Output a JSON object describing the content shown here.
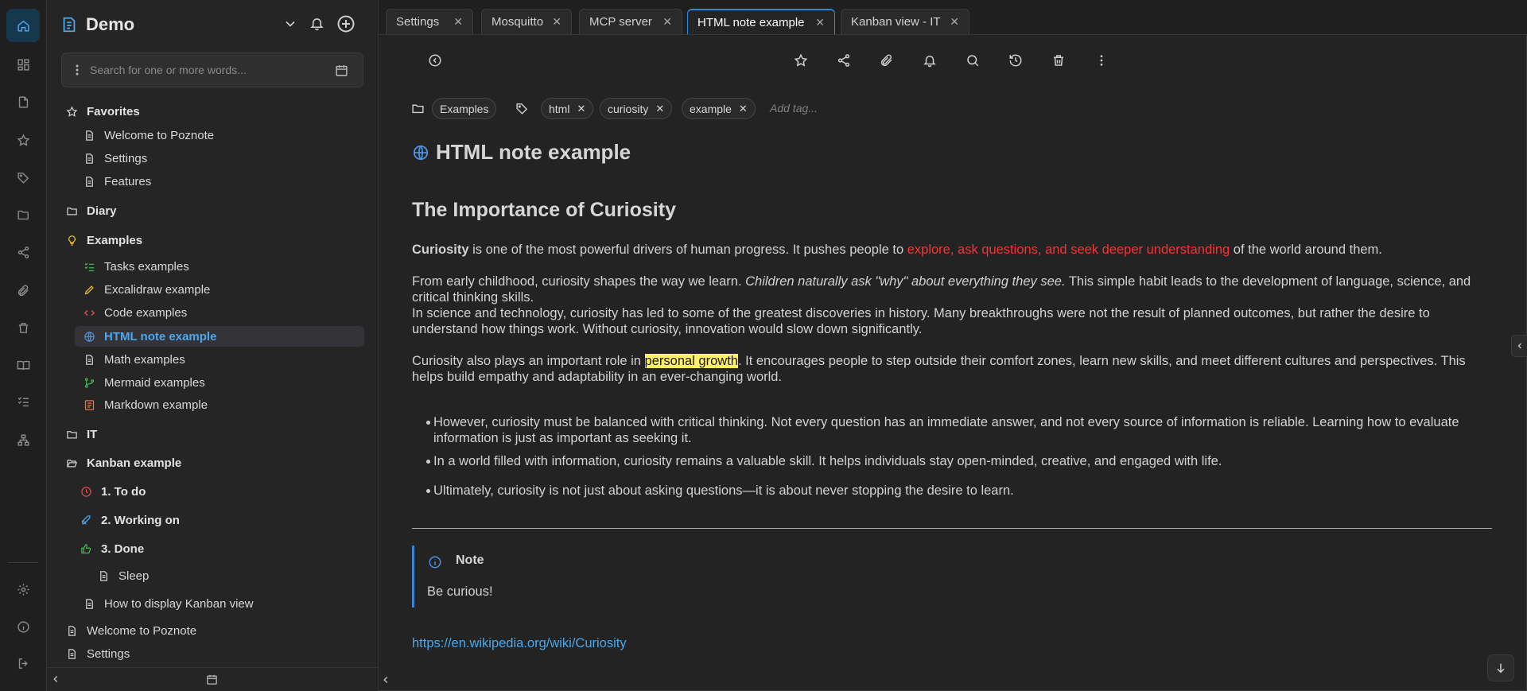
{
  "app": {
    "workspace": "Demo"
  },
  "search": {
    "placeholder": "Search for one or more words..."
  },
  "sidebar": {
    "favorites": {
      "label": "Favorites",
      "items": [
        "Welcome to Poznote",
        "Settings",
        "Features"
      ]
    },
    "diary": "Diary",
    "examples": {
      "label": "Examples",
      "items": [
        "Tasks examples",
        "Excalidraw example",
        "Code examples",
        "HTML note example",
        "Math examples",
        "Mermaid examples",
        "Markdown example"
      ]
    },
    "it": "IT",
    "kanban": {
      "label": "Kanban example",
      "columns": [
        "1. To do",
        "2. Working on",
        "3. Done"
      ],
      "done_items": [
        "Sleep"
      ],
      "items": [
        "How to display Kanban view"
      ]
    },
    "root_items": [
      "Welcome to Poznote",
      "Settings"
    ]
  },
  "tabs": [
    "Settings",
    "Mosquitto",
    "MCP server",
    "HTML note example",
    "Kanban view - IT"
  ],
  "active_tab": "HTML note example",
  "note": {
    "folder": "Examples",
    "tags": [
      "html",
      "curiosity",
      "example"
    ],
    "add_tag_placeholder": "Add tag...",
    "title": "HTML note example",
    "heading": "The Importance of Curiosity",
    "p1": {
      "bold": "Curiosity",
      "before": " is one of the most powerful drivers of human progress. It pushes people to ",
      "red": "explore, ask questions, and seek deeper understanding",
      "after": " of the world around them."
    },
    "p2": {
      "before": "From early childhood, curiosity shapes the way we learn. ",
      "italic": "Children naturally ask \"why\" about everything they see.",
      "after": " This simple habit leads to the development of language, science, and critical thinking skills."
    },
    "p3": "In science and technology, curiosity has led to some of the greatest discoveries in history. Many breakthroughs were not the result of planned outcomes, but rather the desire to understand how things work. Without curiosity, innovation would slow down significantly.",
    "p4": {
      "before": "Curiosity also plays an important role in ",
      "highlight": "personal growth",
      "after": ". It encourages people to step outside their comfort zones, learn new skills, and meet different cultures and perspectives. This helps build empathy and adaptability in an ever-changing world."
    },
    "bullets": [
      "However, curiosity must be balanced with critical thinking. Not every question has an immediate answer, and not every source of information is reliable. Learning how to evaluate information is just as important as seeking it.",
      "In a world filled with information, curiosity remains a valuable skill. It helps individuals stay open-minded, creative, and engaged with life.",
      "Ultimately, curiosity is not just about asking questions—it is about never stopping the desire to learn."
    ],
    "callout": {
      "title": "Note",
      "body": "Be curious!"
    },
    "link": "https://en.wikipedia.org/wiki/Curiosity"
  },
  "colors": {
    "accent": "#4aa8ee",
    "red_text": "#ff3030",
    "highlight": "#fff066",
    "todo": "#e5484d",
    "working": "#4aa8ee",
    "done": "#3fb950"
  }
}
